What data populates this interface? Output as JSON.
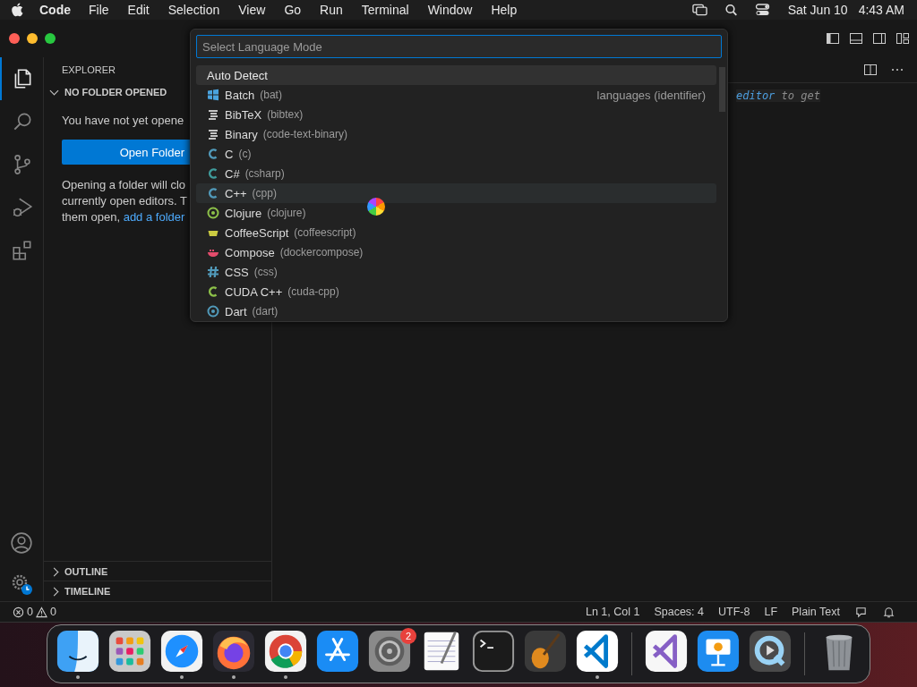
{
  "menu_bar": {
    "app": "Code",
    "menus": [
      "File",
      "Edit",
      "Selection",
      "View",
      "Go",
      "Run",
      "Terminal",
      "Window",
      "Help"
    ],
    "date": "Sat Jun 10",
    "time": "4:43 AM"
  },
  "activity_bar": {
    "items": [
      {
        "kind": "files",
        "selected": true
      },
      {
        "kind": "search",
        "selected": false
      },
      {
        "kind": "source-control",
        "selected": false
      },
      {
        "kind": "run-debug",
        "selected": false
      },
      {
        "kind": "extensions",
        "selected": false
      }
    ]
  },
  "sidebar": {
    "title": "EXPLORER",
    "sections": [
      {
        "title": "NO FOLDER OPENED",
        "expanded": true
      },
      {
        "title": "OUTLINE",
        "expanded": false
      },
      {
        "title": "TIMELINE",
        "expanded": false
      }
    ],
    "message": "You have not yet opene",
    "button": "Open Folder",
    "help_lines": [
      "Opening a folder will clo",
      "currently open editors. T"
    ],
    "help_last": "them open, ",
    "help_link": "add a folder"
  },
  "editor": {
    "hint_keyword": "editor",
    "hint_rest": "to get"
  },
  "quick_pick": {
    "placeholder": "Select Language Mode",
    "header": {
      "label": "Auto Detect",
      "selected": true
    },
    "items": [
      {
        "name": "Batch",
        "id": "(bat)",
        "kind": "windows",
        "color": "#4aa3df",
        "detail": "languages (identifier)",
        "selected": false
      },
      {
        "name": "BibTeX",
        "id": "(bibtex)",
        "kind": "lines",
        "color": "#c5c5c5",
        "selected": false
      },
      {
        "name": "Binary",
        "id": "(code-text-binary)",
        "kind": "lines",
        "color": "#c5c5c5",
        "selected": false
      },
      {
        "name": "C",
        "id": "(c)",
        "kind": "c",
        "color": "#519aba",
        "selected": false
      },
      {
        "name": "C#",
        "id": "(csharp)",
        "kind": "c",
        "color": "#3f9b9b",
        "selected": false
      },
      {
        "name": "C++",
        "id": "(cpp)",
        "kind": "c",
        "color": "#519aba",
        "selected": true
      },
      {
        "name": "Clojure",
        "id": "(clojure)",
        "kind": "ring",
        "color": "#8dc149",
        "selected": false
      },
      {
        "name": "CoffeeScript",
        "id": "(coffeescript)",
        "kind": "cup",
        "color": "#cbcb41",
        "selected": false
      },
      {
        "name": "Compose",
        "id": "(dockercompose)",
        "kind": "whale",
        "color": "#e34c6c",
        "selected": false
      },
      {
        "name": "CSS",
        "id": "(css)",
        "kind": "hash",
        "color": "#519aba",
        "selected": false
      },
      {
        "name": "CUDA C++",
        "id": "(cuda-cpp)",
        "kind": "c",
        "color": "#8dc149",
        "selected": false
      },
      {
        "name": "Dart",
        "id": "(dart)",
        "kind": "ring",
        "color": "#519aba",
        "selected": false
      }
    ]
  },
  "status_bar": {
    "errors": "0",
    "warnings": "0",
    "items": [
      "Ln 1, Col 1",
      "Spaces: 4",
      "UTF-8",
      "LF",
      "Plain Text"
    ]
  },
  "dock": {
    "apps": [
      {
        "kind": "finder",
        "running": true
      },
      {
        "kind": "launchpad",
        "running": false
      },
      {
        "kind": "safari",
        "running": true
      },
      {
        "kind": "firefox",
        "running": true
      },
      {
        "kind": "chrome",
        "running": true
      },
      {
        "kind": "app-store",
        "running": false
      },
      {
        "kind": "settings",
        "running": false,
        "badge": "2"
      },
      {
        "kind": "textedit",
        "running": false
      },
      {
        "kind": "terminal",
        "running": false
      },
      {
        "kind": "guitar",
        "running": false
      },
      {
        "kind": "vscode",
        "running": true
      },
      {
        "kind": "divider"
      },
      {
        "kind": "visual-studio",
        "running": false
      },
      {
        "kind": "keynote",
        "running": false
      },
      {
        "kind": "quicktime",
        "running": false
      },
      {
        "kind": "divider"
      },
      {
        "kind": "trash",
        "running": false
      }
    ]
  }
}
